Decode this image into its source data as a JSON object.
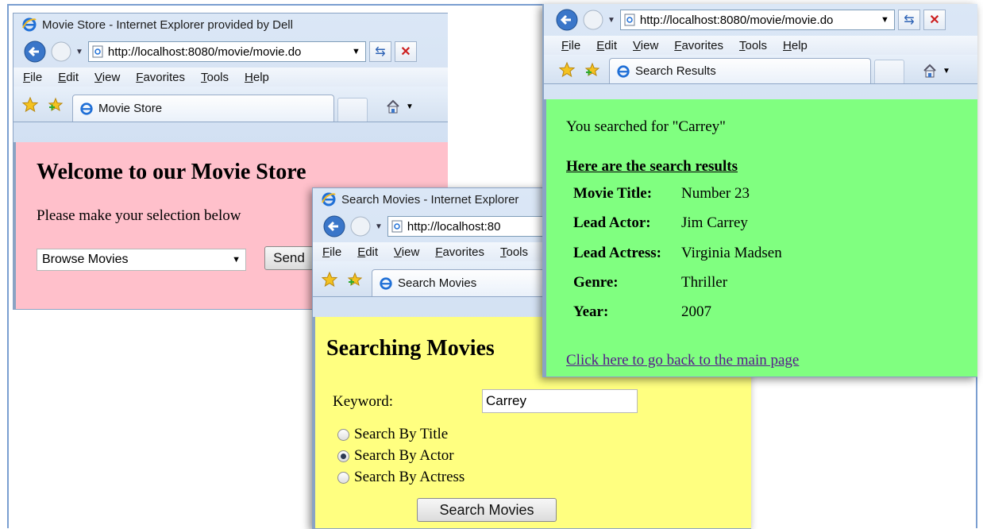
{
  "menu": [
    "File",
    "Edit",
    "View",
    "Favorites",
    "Tools",
    "Help"
  ],
  "windows": {
    "main": {
      "title": "Movie Store - Internet Explorer provided by Dell",
      "url": "http://localhost:8080/movie/movie.do",
      "tab": "Movie Store",
      "heading": "Welcome to our Movie Store",
      "prompt": "Please make your selection below",
      "select_value": "Browse Movies",
      "send_label": "Send",
      "bg_color": "#ffc0cb"
    },
    "search": {
      "title": "Search Movies - Internet Explorer",
      "url": "http://localhost:80",
      "tab": "Search Movies",
      "heading": "Searching Movies",
      "keyword_label": "Keyword:",
      "keyword_value": "Carrey",
      "options": [
        {
          "label": "Search By Title",
          "checked": false
        },
        {
          "label": "Search By Actor",
          "checked": true
        },
        {
          "label": "Search By Actress",
          "checked": false
        }
      ],
      "submit_label": "Search Movies",
      "bg_color": "#ffff80"
    },
    "results": {
      "url": "http://localhost:8080/movie/movie.do",
      "tab": "Search Results",
      "searched_text": "You searched for \"Carrey\"",
      "results_heading": "Here are the search results",
      "rows": [
        {
          "label": "Movie Title:",
          "value": "Number 23"
        },
        {
          "label": "Lead Actor:",
          "value": "Jim Carrey"
        },
        {
          "label": "Lead Actress:",
          "value": "Virginia Madsen"
        },
        {
          "label": "Genre:",
          "value": "Thriller"
        },
        {
          "label": "Year:",
          "value": "2007"
        }
      ],
      "back_link": "Click here to go back to the main page",
      "bg_color": "#80ff80"
    }
  }
}
